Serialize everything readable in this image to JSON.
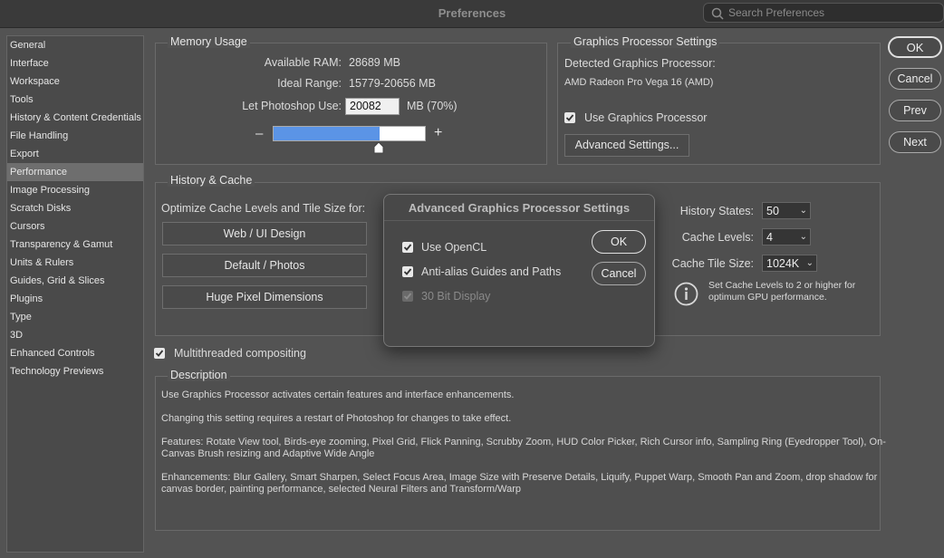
{
  "window": {
    "title": "Preferences",
    "search_placeholder": "Search Preferences"
  },
  "sidebar": {
    "items": [
      {
        "label": "General"
      },
      {
        "label": "Interface"
      },
      {
        "label": "Workspace"
      },
      {
        "label": "Tools"
      },
      {
        "label": "History & Content Credentials"
      },
      {
        "label": "File Handling"
      },
      {
        "label": "Export"
      },
      {
        "label": "Performance",
        "selected": true
      },
      {
        "label": "Image Processing"
      },
      {
        "label": "Scratch Disks"
      },
      {
        "label": "Cursors"
      },
      {
        "label": "Transparency & Gamut"
      },
      {
        "label": "Units & Rulers"
      },
      {
        "label": "Guides, Grid & Slices"
      },
      {
        "label": "Plugins"
      },
      {
        "label": "Type"
      },
      {
        "label": "3D"
      },
      {
        "label": "Enhanced Controls"
      },
      {
        "label": "Technology Previews"
      }
    ]
  },
  "memory": {
    "label": "Memory Usage",
    "available_label": "Available RAM:",
    "available_value": "28689 MB",
    "ideal_label": "Ideal Range:",
    "ideal_value": "15779-20656 MB",
    "let_use_label": "Let Photoshop Use:",
    "let_use_value": "20082",
    "let_use_unit": "MB (70%)",
    "minus": "–",
    "plus": "+",
    "slider_level": 0.7
  },
  "gpu": {
    "label": "Graphics Processor Settings",
    "detected_label": "Detected Graphics Processor:",
    "detected_value": "AMD Radeon Pro Vega 16 (AMD)",
    "use_label": "Use Graphics Processor",
    "use_checked": true,
    "advanced_button": "Advanced Settings..."
  },
  "history_cache": {
    "label": "History & Cache",
    "optimize_label": "Optimize Cache Levels and Tile Size for:",
    "buttons": [
      "Web / UI Design",
      "Default / Photos",
      "Huge Pixel Dimensions"
    ],
    "history_states_label": "History States:",
    "history_states_value": "50",
    "cache_levels_label": "Cache Levels:",
    "cache_levels_value": "4",
    "tile_size_label": "Cache Tile Size:",
    "tile_size_value": "1024K",
    "info_line1": "Set Cache Levels to 2 or higher for",
    "info_line2": "optimum GPU performance."
  },
  "multithreaded": {
    "label": "Multithreaded compositing",
    "checked": true
  },
  "description": {
    "label": "Description",
    "p1": "Use Graphics Processor activates certain features and interface enhancements.",
    "p2": "Changing this setting requires a restart of Photoshop for changes to take effect.",
    "p3a": "Features: Rotate View tool, Birds-eye zooming, Pixel Grid, Flick Panning, Scrubby Zoom, HUD Color Picker, Rich Cursor info, Sampling Ring (Eyedropper Tool), On-",
    "p3b": "Canvas Brush resizing and Adaptive Wide Angle",
    "p4a": "Enhancements: Blur Gallery, Smart Sharpen, Select Focus Area, Image Size with Preserve Details, Liquify, Puppet Warp, Smooth Pan and Zoom, drop shadow for",
    "p4b": "canvas border, painting performance, selected Neural Filters and Transform/Warp"
  },
  "right_buttons": {
    "ok": "OK",
    "cancel": "Cancel",
    "prev": "Prev",
    "next": "Next"
  },
  "modal": {
    "title": "Advanced Graphics Processor Settings",
    "opencl_label": "Use OpenCL",
    "antialias_label": "Anti-alias Guides and Paths",
    "bit30_label": "30 Bit Display",
    "ok": "OK",
    "cancel": "Cancel"
  },
  "colors": {
    "slider_fill": "#5b94e6",
    "background": "#535353"
  }
}
